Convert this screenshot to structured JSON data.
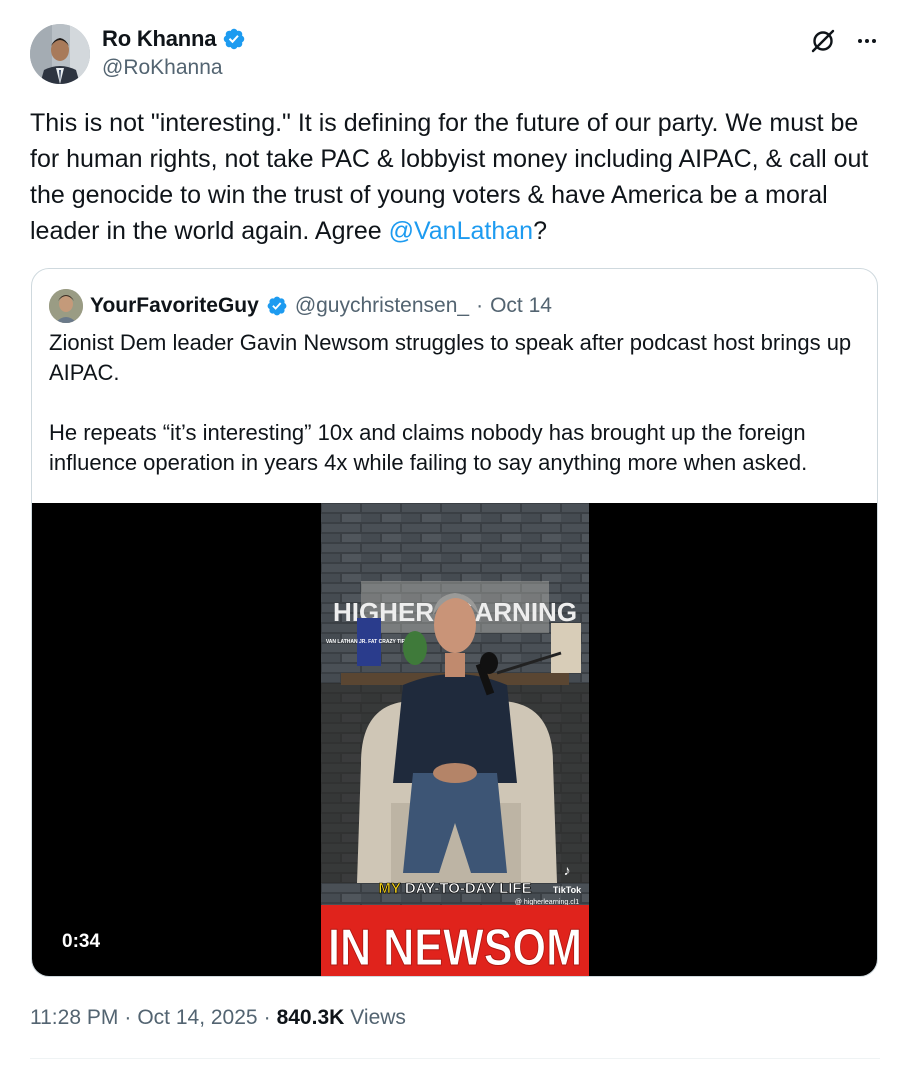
{
  "author": {
    "display_name": "Ro Khanna",
    "handle": "@RoKhanna"
  },
  "tweet": {
    "text_before_mention": "This is not \"interesting.\" It is defining for the future of our party. We must be for human rights, not take PAC & lobbyist money including AIPAC, & call out the genocide to win the trust of young voters & have America be a moral leader in the world again. Agree ",
    "mention": "@VanLathan",
    "text_after_mention": "?"
  },
  "quoted": {
    "display_name": "YourFavoriteGuy",
    "handle": "@guychristensen_",
    "separator": "·",
    "date": "Oct 14",
    "paragraph_1": "Zionist Dem leader Gavin Newsom struggles to speak after podcast host brings up AIPAC.",
    "paragraph_2": "He repeats “it’s interesting” 10x and claims nobody has brought up the foreign influence operation in years 4x while failing to say anything more when asked.",
    "video": {
      "duration": "0:34",
      "sign_text": "HIGHER LEARNING",
      "book_text": "VAN LATHAN JR. FAT CRAZY TIRED",
      "caption_prefix": "MY",
      "caption_rest": "DAY-TO-DAY LIFE",
      "tiktok_label": "TikTok",
      "tiktok_handle": "@ higherlearning.cl1",
      "banner_text": "IN NEWSOM"
    }
  },
  "meta": {
    "time": "11:28 PM",
    "date": "Oct 14, 2025",
    "separator": "·",
    "views_count": "840.3K",
    "views_label": "Views"
  },
  "colors": {
    "text": "#0f1419",
    "secondary": "#536471",
    "link": "#1d9bf0",
    "verified": "#1d9bf0",
    "border": "#cfd9de",
    "banner_red": "#e0231c"
  },
  "icons": {
    "verified": "verified-badge-icon",
    "grok": "grok-icon",
    "more": "more-icon",
    "tiktok": "tiktok-icon"
  }
}
